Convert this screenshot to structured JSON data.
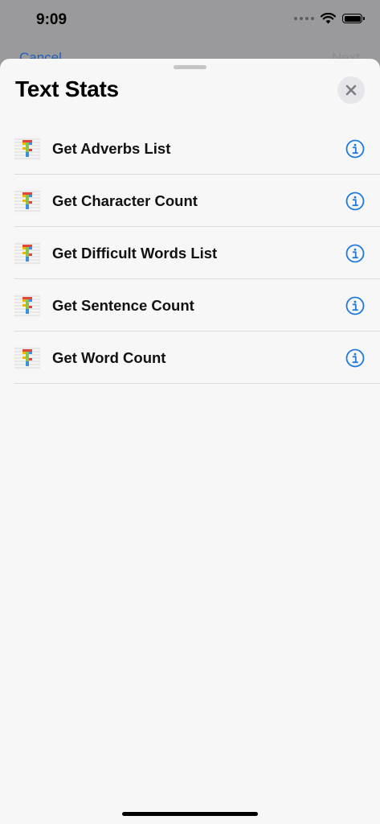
{
  "status_bar": {
    "time": "9:09"
  },
  "background_nav": {
    "cancel_label": "Cancel",
    "next_label": "Next"
  },
  "sheet": {
    "title": "Text Stats",
    "items": [
      {
        "label": "Get Adverbs List"
      },
      {
        "label": "Get Character Count"
      },
      {
        "label": "Get Difficult Words List"
      },
      {
        "label": "Get Sentence Count"
      },
      {
        "label": "Get Word Count"
      }
    ]
  },
  "colors": {
    "accent": "#1f7ae0",
    "sheet_bg": "#f7f7f7",
    "dimmed_bg": "#9a9a9c"
  },
  "icons": {
    "close": "close-icon",
    "info": "info-icon",
    "action": "text-stats-app-icon"
  }
}
